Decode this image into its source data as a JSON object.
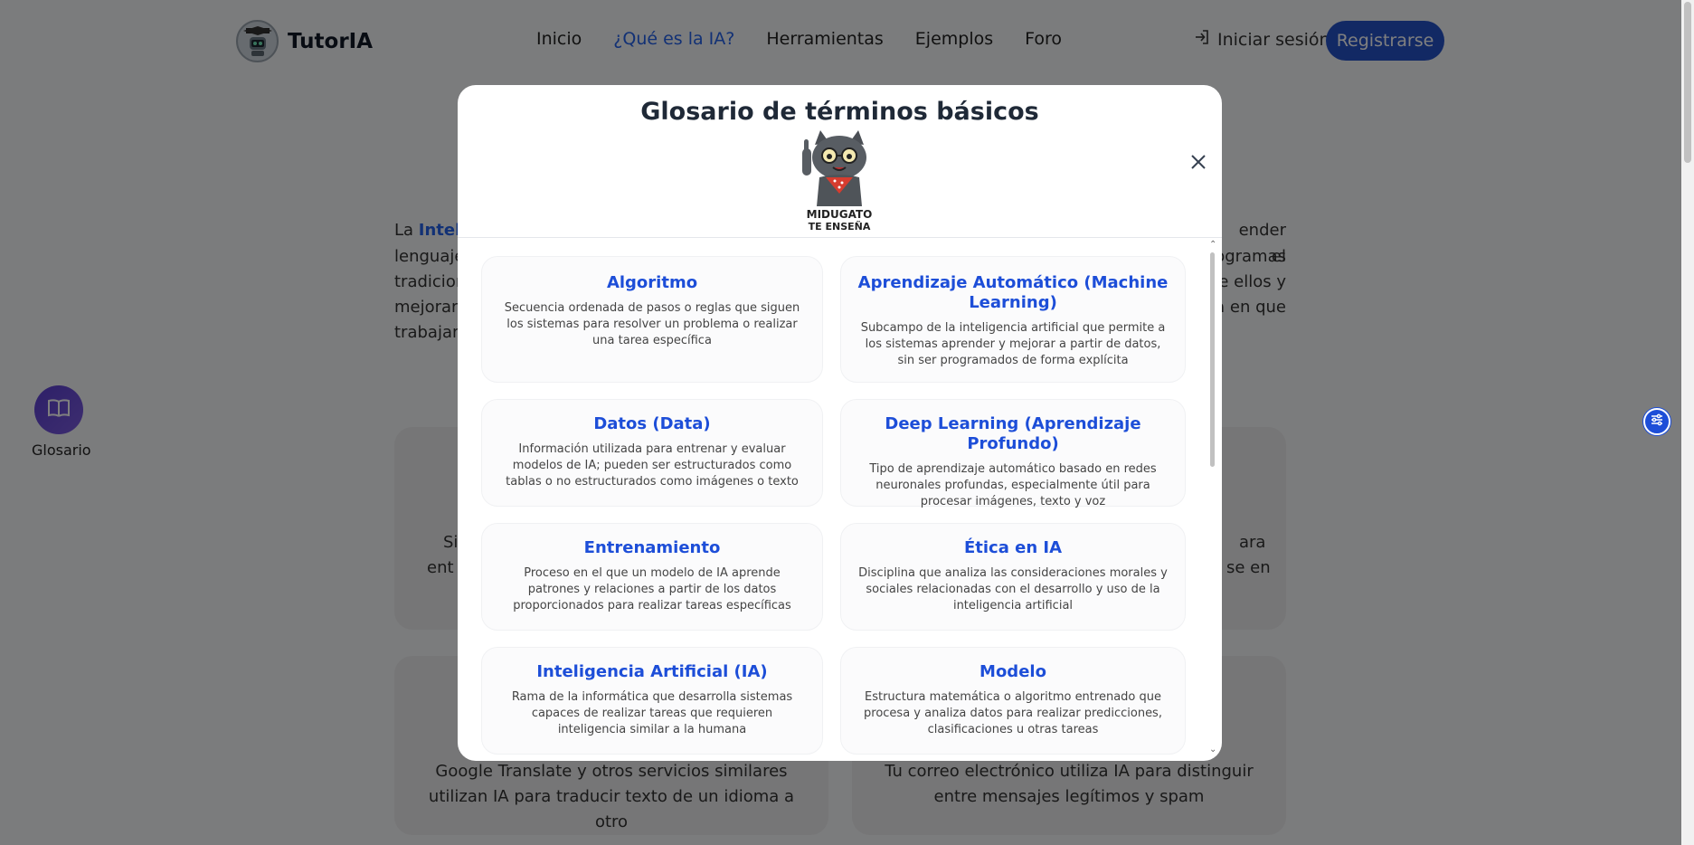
{
  "brand": {
    "name": "TutorIA",
    "logo_icon": "robot-graduate-icon"
  },
  "nav": {
    "links": [
      "Inicio",
      "¿Qué es la IA?",
      "Herramientas",
      "Ejemplos",
      "Foro"
    ],
    "active_index": 1,
    "login_label": "Iniciar sesión",
    "register_label": "Registrarse"
  },
  "background": {
    "para_start": "La ",
    "para_highlight": "Intelig",
    "para_lines_right": [
      "ender el",
      "ogramas",
      "e ellos y",
      "a en que"
    ],
    "para_lines_left": [
      "lenguaje",
      "tradicion",
      "mejorar",
      "trabajam"
    ],
    "card1_left": "Si",
    "card1_left2": "ent",
    "card1_right": "ara",
    "card1_right2": "se en",
    "card2_text": "Google Translate y otros servicios similares utilizan IA para traducir texto de un idioma a otro",
    "card3_text": "Tu correo electrónico utiliza IA para distinguir entre mensajes legítimos y spam"
  },
  "sidebar": {
    "glosario_label": "Glosario",
    "icon": "book-open-icon"
  },
  "modal": {
    "title": "Glosario de términos básicos",
    "mascot_caption_1": "MIDUGATO",
    "mascot_caption_2": "TE ENSEÑA",
    "terms": [
      {
        "title": "Algoritmo",
        "desc": "Secuencia ordenada de pasos o reglas que siguen los sistemas para resolver un problema o realizar una tarea específica"
      },
      {
        "title": "Aprendizaje Automático (Machine Learning)",
        "desc": "Subcampo de la inteligencia artificial que permite a los sistemas aprender y mejorar a partir de datos, sin ser programados de forma explícita"
      },
      {
        "title": "Datos (Data)",
        "desc": "Información utilizada para entrenar y evaluar modelos de IA; pueden ser estructurados como tablas o no estructurados como imágenes o texto"
      },
      {
        "title": "Deep Learning (Aprendizaje Profundo)",
        "desc": "Tipo de aprendizaje automático basado en redes neuronales profundas, especialmente útil para procesar imágenes, texto y voz"
      },
      {
        "title": "Entrenamiento",
        "desc": "Proceso en el que un modelo de IA aprende patrones y relaciones a partir de los datos proporcionados para realizar tareas específicas"
      },
      {
        "title": "Ética en IA",
        "desc": "Disciplina que analiza las consideraciones morales y sociales relacionadas con el desarrollo y uso de la inteligencia artificial"
      },
      {
        "title": "Inteligencia Artificial (IA)",
        "desc": "Rama de la informática que desarrolla sistemas capaces de realizar tareas que requieren inteligencia similar a la humana"
      },
      {
        "title": "Modelo",
        "desc": "Estructura matemática o algoritmo entrenado que procesa y analiza datos para realizar predicciones, clasificaciones u otras tareas"
      }
    ]
  },
  "colors": {
    "accent": "#1d4ed8",
    "register_bg": "#2553c9",
    "glosario_gradient": "#5b3fd1"
  }
}
